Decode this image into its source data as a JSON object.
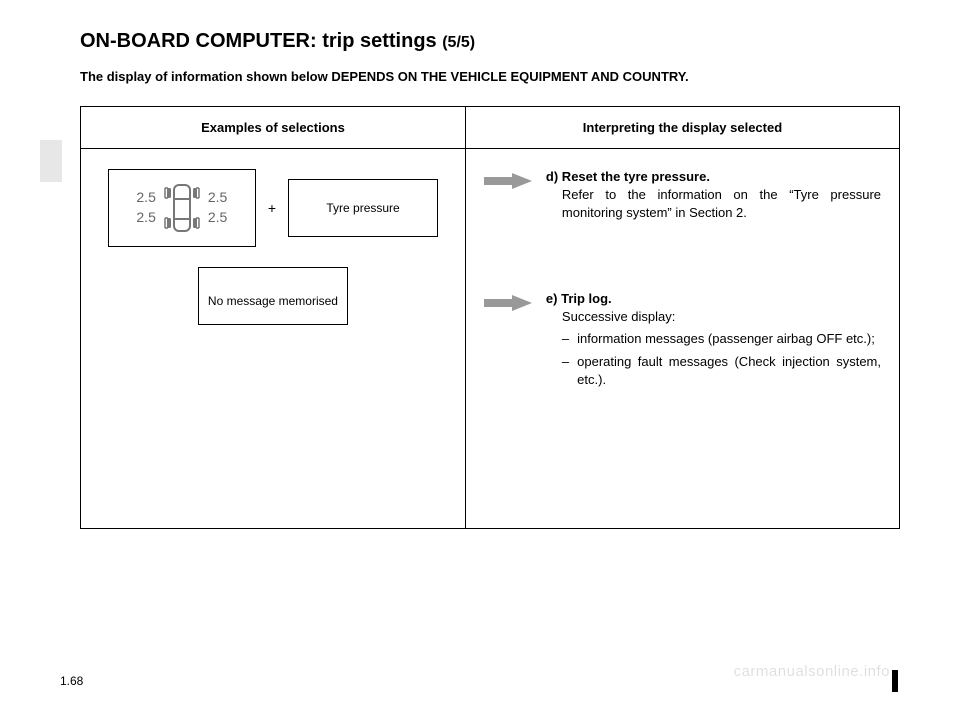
{
  "title_main": "ON-BOARD COMPUTER: trip settings ",
  "title_sub": "(5/5)",
  "intro": "The display of information shown below DEPENDS ON THE VEHICLE EQUIPMENT AND COUNTRY.",
  "table": {
    "head_left": "Examples of selections",
    "head_right": "Interpreting the display selected"
  },
  "tyre": {
    "fl": "2.5",
    "fr": "2.5",
    "rl": "2.5",
    "rr": "2.5",
    "plus": "+",
    "label": "Tyre pressure"
  },
  "msg_box": "No message memorised",
  "right": {
    "d_label": "d) Reset the tyre pressure.",
    "d_body": "Refer to the information on the “Tyre pressure monitoring system” in Section 2.",
    "e_label": "e) Trip log.",
    "e_body": "Successive display:",
    "e_item1": "information messages (passenger airbag OFF etc.);",
    "e_item2": "operating fault messages (Check injection system, etc.).",
    "dash": "–"
  },
  "page_num": "1.68",
  "watermark": "carmanualsonline.info"
}
